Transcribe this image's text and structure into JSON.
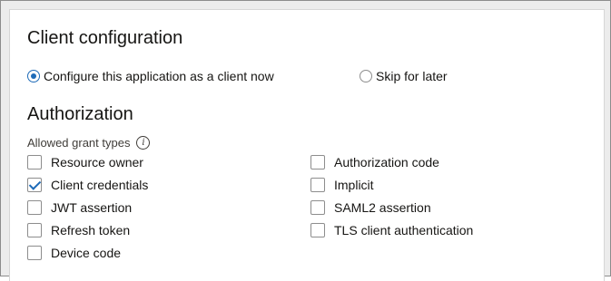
{
  "client_config": {
    "title": "Client configuration",
    "options": [
      {
        "label": "Configure this application as a client now",
        "selected": true
      },
      {
        "label": "Skip for later",
        "selected": false
      }
    ]
  },
  "authorization": {
    "title": "Authorization",
    "grant_types_label": "Allowed grant types",
    "grant_types": [
      {
        "label": "Resource owner",
        "checked": false
      },
      {
        "label": "Client credentials",
        "checked": true
      },
      {
        "label": "JWT assertion",
        "checked": false
      },
      {
        "label": "Refresh token",
        "checked": false
      },
      {
        "label": "Device code",
        "checked": false
      },
      {
        "label": "Authorization code",
        "checked": false
      },
      {
        "label": "Implicit",
        "checked": false
      },
      {
        "label": "SAML2 assertion",
        "checked": false
      },
      {
        "label": "TLS client authentication",
        "checked": false
      }
    ]
  },
  "colors": {
    "accent": "#1e6bb8",
    "border": "#8d8d8d"
  }
}
